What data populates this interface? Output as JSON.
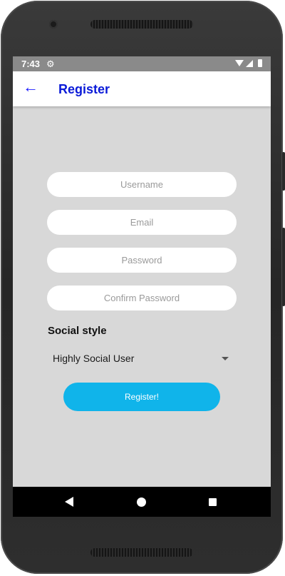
{
  "status_bar": {
    "time": "7:43",
    "settings_icon": "gear-icon",
    "wifi_icon": "wifi-icon",
    "signal_icon": "signal-icon",
    "battery_icon": "battery-icon"
  },
  "app_bar": {
    "back_icon": "arrow-left-icon",
    "title": "Register",
    "title_color": "#0a1ad8"
  },
  "form": {
    "username": {
      "value": "",
      "placeholder": "Username"
    },
    "email": {
      "value": "",
      "placeholder": "Email"
    },
    "password": {
      "value": "",
      "placeholder": "Password"
    },
    "confirm_password": {
      "value": "",
      "placeholder": "Confirm Password"
    },
    "social_style_label": "Social style",
    "social_style_selected": "Highly Social User",
    "submit_label": "Register!",
    "submit_color": "#10b4ea"
  },
  "nav_bar": {
    "back_icon": "triangle-back-icon",
    "home_icon": "circle-home-icon",
    "recents_icon": "square-recents-icon"
  }
}
